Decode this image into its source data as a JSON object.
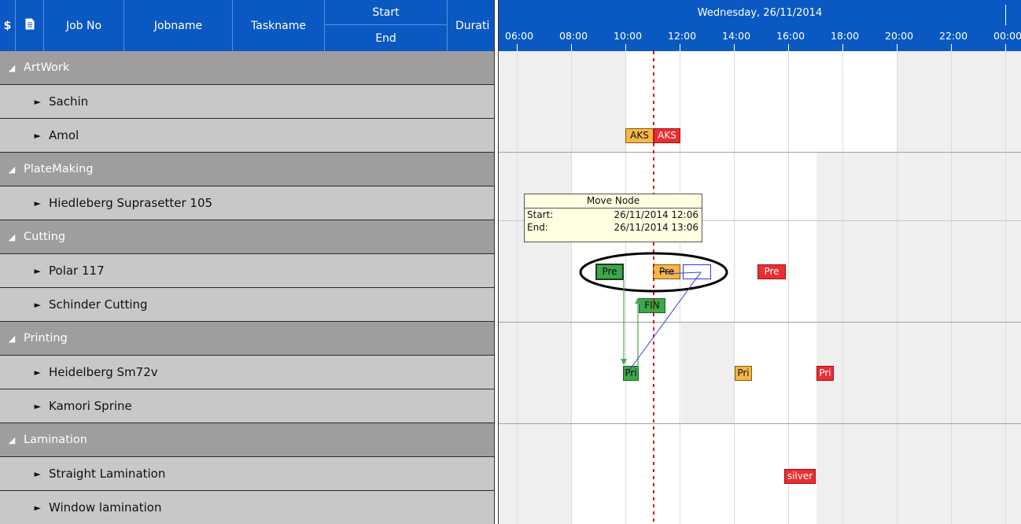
{
  "columns": {
    "currency_symbol": "$",
    "job_no": "Job No",
    "jobname": "Jobname",
    "taskname": "Taskname",
    "start": "Start",
    "end": "End",
    "duration": "Durati"
  },
  "groups": [
    {
      "label": "ArtWork",
      "children": [
        "Sachin",
        "Amol"
      ]
    },
    {
      "label": "PlateMaking",
      "children": [
        "Hiedleberg Suprasetter 105"
      ]
    },
    {
      "label": "Cutting",
      "children": [
        "Polar 117",
        "Schinder Cutting"
      ]
    },
    {
      "label": "Printing",
      "children": [
        "Heidelberg Sm72v",
        "Kamori Sprine"
      ]
    },
    {
      "label": "Lamination",
      "children": [
        "Straight Lamination",
        "Window lamination"
      ]
    }
  ],
  "timeline": {
    "day": "Wednesday, 26/11/2014",
    "hours": [
      "06:00",
      "08:00",
      "10:00",
      "12:00",
      "14:00",
      "16:00",
      "18:00",
      "20:00",
      "22:00",
      "00:00"
    ]
  },
  "tasks": {
    "aks1": "AKS",
    "aks2": "AKS",
    "pre_green": "Pre",
    "pre_orange": "Pre",
    "pre_red": "Pre",
    "fin": "FIN",
    "pri_green": "Pri",
    "pri_orange": "Pri",
    "pri_red": "Pri",
    "silver": "silver"
  },
  "tooltip": {
    "title": "Move Node",
    "start_label": "Start:",
    "start_value": "26/11/2014 12:06",
    "end_label": "End:",
    "end_value": "26/11/2014 13:06"
  },
  "colors": {
    "header_blue": "#0a59c2",
    "group_gray": "#9e9e9e",
    "row_gray": "#c8c8c8",
    "task_orange": "#f7b64a",
    "task_red": "#ec2d32",
    "task_green": "#3ba84a",
    "now_line": "#e0000a",
    "tooltip_bg": "#ffffe1"
  }
}
